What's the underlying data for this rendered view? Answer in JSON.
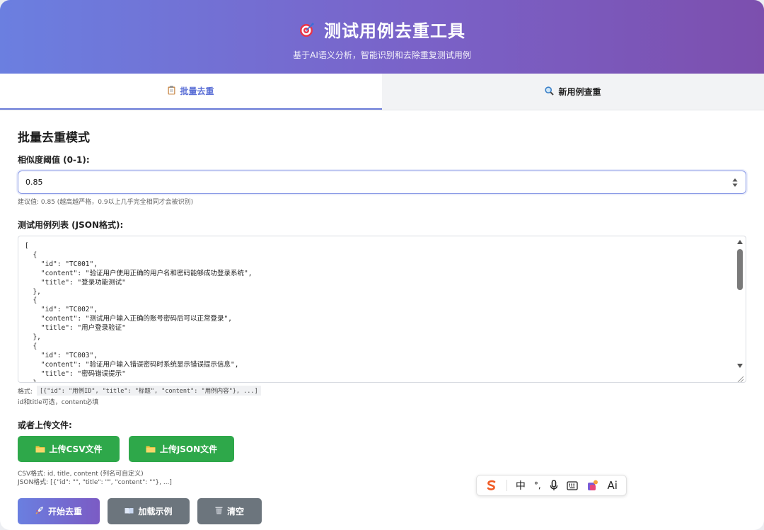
{
  "header": {
    "title": "测试用例去重工具",
    "subtitle": "基于AI语义分析，智能识别和去除重复测试用例"
  },
  "tabs": [
    {
      "label": "批量去重",
      "icon": "clipboard-icon",
      "active": true
    },
    {
      "label": "新用例查重",
      "icon": "magnifier-icon",
      "active": false
    }
  ],
  "batch": {
    "mode_title": "批量去重模式",
    "threshold_label": "相似度阈值 (0-1):",
    "threshold_value": "0.85",
    "threshold_hint": "建议值: 0.85 (越高越严格，0.9以上几乎完全相同才会被识别)",
    "json_label": "测试用例列表 (JSON格式):",
    "json_text": "[\n  {\n    \"id\": \"TC001\",\n    \"content\": \"验证用户使用正确的用户名和密码能够成功登录系统\",\n    \"title\": \"登录功能测试\"\n  },\n  {\n    \"id\": \"TC002\",\n    \"content\": \"测试用户输入正确的账号密码后可以正常登录\",\n    \"title\": \"用户登录验证\"\n  },\n  {\n    \"id\": \"TC003\",\n    \"content\": \"验证用户输入错误密码时系统显示错误提示信息\",\n    \"title\": \"密码错误提示\"\n  }",
    "format_prefix": "格式:",
    "format_example": "[{\"id\": \"用例ID\", \"title\": \"标题\", \"content\": \"用例内容\"}, ...]",
    "format_note": "id和title可选，content必填",
    "upload_label": "或者上传文件:",
    "upload_csv_label": "上传CSV文件",
    "upload_json_label": "上传JSON文件",
    "csv_hint": "CSV格式: id, title, content (列名可自定义)",
    "json_hint": "JSON格式: [{\"id\": \"\", \"title\": \"\", \"content\": \"\"}, ...]",
    "start_label": "开始去重",
    "load_example_label": "加载示例",
    "clear_label": "清空"
  },
  "ime_toolbar": {
    "lang": "中",
    "punct": "°,",
    "ai_label": "Ai"
  },
  "colors": {
    "header_start": "#6b7fe0",
    "header_end": "#7c4fae",
    "active_tab": "#5b6fd6",
    "green_button": "#2ea84a",
    "gray_button": "#6c757d"
  }
}
